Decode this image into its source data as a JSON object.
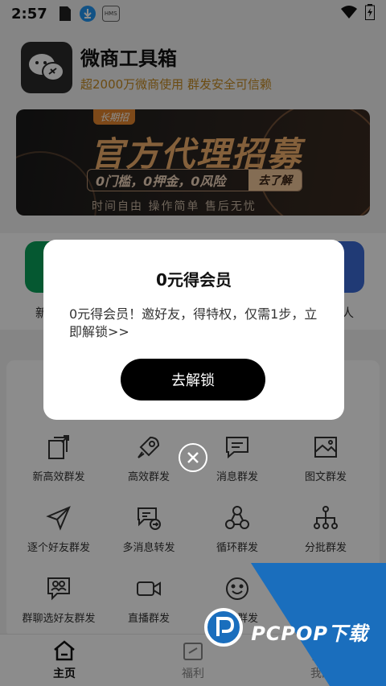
{
  "status_bar": {
    "time": "2:57",
    "hms_label": "HMS"
  },
  "app": {
    "title": "微商工具箱",
    "subtitle": "超2000万微商使用  群发安全可信赖"
  },
  "banner": {
    "tag": "长期招",
    "headline": "官方代理招募",
    "pill_text": "0门槛，0押金，0风险",
    "pill_button": "去了解",
    "tagline": "时间自由  操作简单  售后无忧"
  },
  "quick_row": {
    "items": [
      {
        "label": "新高",
        "color": "#0aa15a"
      },
      {
        "label": "加人",
        "color": "#3b6bd6"
      }
    ]
  },
  "tools": [
    {
      "label": "新高效群发",
      "icon": "share-document-icon"
    },
    {
      "label": "高效群发",
      "icon": "rocket-icon"
    },
    {
      "label": "消息群发",
      "icon": "message-icon"
    },
    {
      "label": "图文群发",
      "icon": "picture-icon"
    },
    {
      "label": "逐个好友群发",
      "icon": "send-plane-icon"
    },
    {
      "label": "多消息转发",
      "icon": "forward-messages-icon"
    },
    {
      "label": "循环群发",
      "icon": "cycle-icon"
    },
    {
      "label": "分批群发",
      "icon": "tree-icon"
    },
    {
      "label": "群聊选好友群发",
      "icon": "group-chat-icon"
    },
    {
      "label": "直播群发",
      "icon": "video-icon"
    },
    {
      "label": "表情群发",
      "icon": "smiley-icon"
    }
  ],
  "tab_bar": {
    "tabs": [
      {
        "label": "主页",
        "active": true
      },
      {
        "label": "福利",
        "active": false
      },
      {
        "label": "我的",
        "active": false
      }
    ]
  },
  "dialog": {
    "title": "0元得会员",
    "body": "0元得会员！邀好友，得特权，仅需1步，立即解锁>>",
    "button": "去解锁"
  },
  "watermark": {
    "text": "PCPOP下载"
  }
}
